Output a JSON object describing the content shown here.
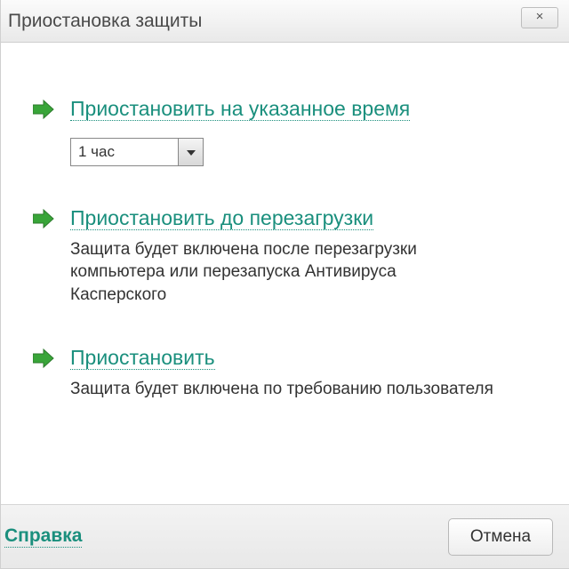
{
  "window": {
    "title": "Приостановка защиты",
    "close_symbol": "×"
  },
  "options": {
    "for_time": {
      "label": "Приостановить на указанное время",
      "selected_value": "1 час"
    },
    "until_reboot": {
      "label": "Приостановить до перезагрузки",
      "desc": "Защита будет включена после перезагрузки компьютера или перезапуска Антивируса Касперского"
    },
    "pause": {
      "label": "Приостановить",
      "desc": "Защита будет включена по требованию пользователя"
    }
  },
  "footer": {
    "help_label": "Справка",
    "cancel_label": "Отмена"
  },
  "colors": {
    "accent": "#1a8f7d",
    "arrow": "#39a539"
  }
}
